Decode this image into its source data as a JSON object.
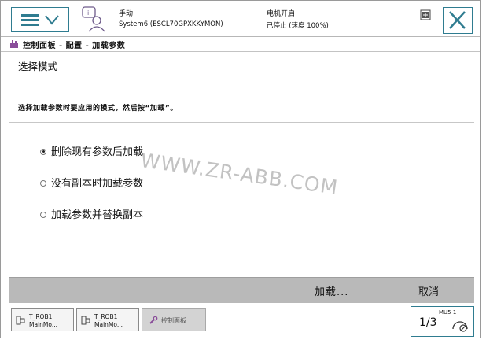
{
  "header": {
    "mode": "手动",
    "system": "System6 (ESCL70GPXKKYMON)",
    "motor_state": "电机开启",
    "run_state": "已停止 (速度 100%)"
  },
  "breadcrumb": "控制面板 - 配置 - 加载参数",
  "content": {
    "title": "选择模式",
    "instruction": "选择加载参数时要应用的模式，然后按“加载”。",
    "options": [
      {
        "label": "删除现有参数后加载",
        "checked": true
      },
      {
        "label": "没有副本时加载参数",
        "checked": false
      },
      {
        "label": "加载参数并替换副本",
        "checked": false
      }
    ],
    "watermark": "WWW.ZR-ABB.COM"
  },
  "commands": {
    "load": "加载...",
    "cancel": "取消"
  },
  "taskbar": {
    "tasks": [
      {
        "line1": "T_ROB1",
        "line2": "MainMo..."
      },
      {
        "line1": "T_ROB1",
        "line2": "MainMo..."
      }
    ],
    "active": "控制面板",
    "quickset": {
      "mu": "MU5 1",
      "fraction": "1/3"
    }
  },
  "colors": {
    "accent": "#2f7c90",
    "command_bar": "#b9b9b9"
  }
}
